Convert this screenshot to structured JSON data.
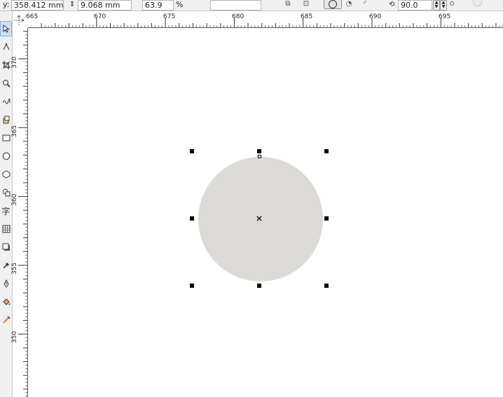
{
  "property_bar": {
    "y_label": "y:",
    "y_value": "358.412 mm",
    "height_value": "9.068 mm",
    "scale_value": "63.9",
    "percent_label": "%",
    "rotation_value": "90.0"
  },
  "ruler": {
    "horizontal_ticks": [
      "665",
      "670",
      "675",
      "680",
      "685",
      "690",
      "695"
    ],
    "vertical_ticks": [
      "370",
      "365",
      "360",
      "355",
      "350"
    ]
  },
  "toolbox": {
    "text_tool_label": "字"
  },
  "canvas": {
    "ellipse_fill": "#dcdad7",
    "background": "#ffffff"
  }
}
